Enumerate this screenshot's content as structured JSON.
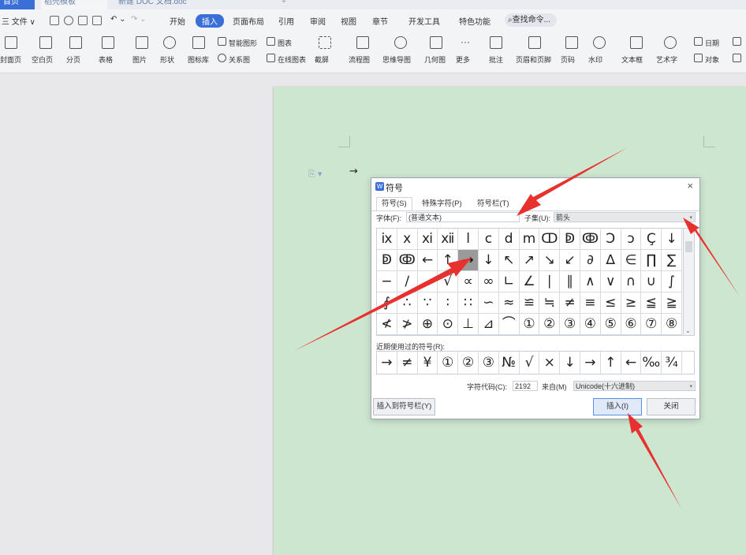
{
  "tabs": {
    "home": "首页",
    "template": "稻壳模板",
    "doc": "新建 DOC 文档.doc",
    "add": "+"
  },
  "menu": {
    "file": "三 文件 ∨",
    "start": "开始",
    "insert": "插入",
    "layout": "页面布局",
    "ref": "引用",
    "review": "审阅",
    "view": "视图",
    "chapter": "章节",
    "dev": "开发工具",
    "special": "特色功能",
    "search": "查找命令..."
  },
  "toolbar": {
    "cover": "封面页",
    "blank": "空白页",
    "pagebreak": "分页",
    "table": "表格",
    "picture": "图片",
    "shape": "形状",
    "iconlib": "图标库",
    "smartart": "智能图形",
    "chart": "图表",
    "relation": "关系图",
    "onlinechart": "在线图表",
    "screenshot": "截屏",
    "flow": "流程图",
    "mindmap": "思维导图",
    "geometry": "几何图",
    "more": "更多",
    "comment": "批注",
    "header": "页眉和页脚",
    "pagenum": "页码",
    "watermark": "水印",
    "textbox": "文本框",
    "wordart": "艺术字",
    "date": "日期",
    "object": "对象"
  },
  "doc": {
    "arrow_char": "→"
  },
  "dialog": {
    "title": "符号",
    "tabs": [
      "符号(S)",
      "特殊字符(P)",
      "符号栏(T)"
    ],
    "font_label": "字体(F):",
    "font_value": "(普通文本)",
    "subset_label": "子集(U):",
    "subset_value": "箭头",
    "symbols": [
      [
        "ⅸ",
        "ⅹ",
        "ⅺ",
        "ⅻ",
        "ⅼ",
        "ⅽ",
        "ⅾ",
        "ⅿ",
        "ↀ",
        "ↁ",
        "ↂ",
        "Ↄ",
        "ↄ",
        "Ç",
        "↓"
      ],
      [
        "ↁ",
        "ↂ",
        "←",
        "↑",
        "→",
        "↓",
        "↖",
        "↗",
        "↘",
        "↙",
        "∂",
        "∆",
        "∈",
        "∏",
        "∑"
      ],
      [
        "−",
        "∕",
        "",
        "√",
        "∝",
        "∞",
        "∟",
        "∠",
        "∣",
        "∥",
        "∧",
        "∨",
        "∩",
        "∪",
        "∫"
      ],
      [
        "∮",
        "∴",
        "∵",
        "∶",
        "∷",
        "∽",
        "≈",
        "≌",
        "≒",
        "≠",
        "≡",
        "≤",
        "≥",
        "≦",
        "≧"
      ],
      [
        "≮",
        "≯",
        "⊕",
        "⊙",
        "⊥",
        "⊿",
        "⌒",
        "①",
        "②",
        "③",
        "④",
        "⑤",
        "⑥",
        "⑦",
        "⑧"
      ]
    ],
    "recent_label": "近期使用过的符号(R):",
    "recent": [
      "→",
      "≠",
      "¥",
      "①",
      "②",
      "③",
      "№",
      "√",
      "×",
      "↓",
      "→",
      "↑",
      "←",
      "‰",
      "¾"
    ],
    "code_label": "字符代码(C):",
    "code_value": "2192",
    "from_label": "来自(M)",
    "from_value": "Unicode(十六进制)",
    "btn_toolbar": "插入到符号栏(Y)",
    "btn_insert": "插入(I)",
    "btn_close": "关闭"
  },
  "colors": {
    "page_bg": "#cde6cf",
    "accent": "#3a6fd8",
    "arrow": "#e8312f"
  }
}
